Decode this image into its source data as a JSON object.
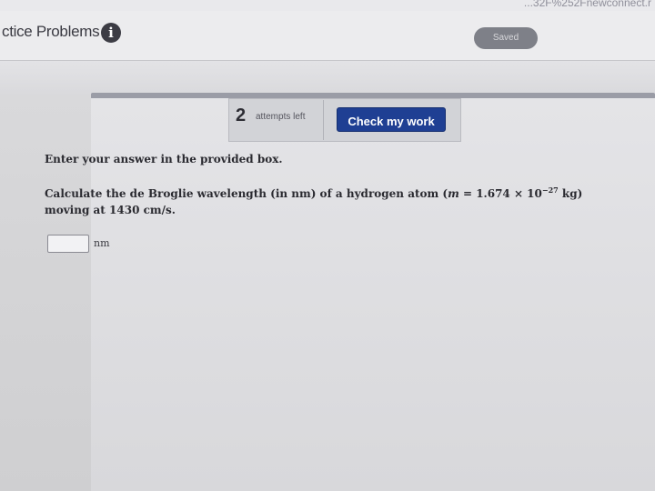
{
  "browser": {
    "url_fragment": "...32F%252Fnewconnect.r"
  },
  "header": {
    "title": "ctice Problems",
    "saved_label": "Saved"
  },
  "toolbar": {
    "attempts_count": "2",
    "attempts_label": "attempts left",
    "check_label": "Check my work"
  },
  "question": {
    "instruction": "Enter your answer in the provided box.",
    "text_before_mass": "Calculate the de Broglie wavelength (in nm) of a hydrogen atom (",
    "mass_symbol": "m",
    "mass_value": " = 1.674 × 10",
    "mass_exponent": "−27",
    "text_after_mass": " kg) moving at 1430 cm/s.",
    "answer_value": "",
    "answer_unit": "nm"
  },
  "colors": {
    "check_button": "#1f3f93",
    "saved_badge": "#7e8088",
    "info_icon": "#3c3c44"
  }
}
